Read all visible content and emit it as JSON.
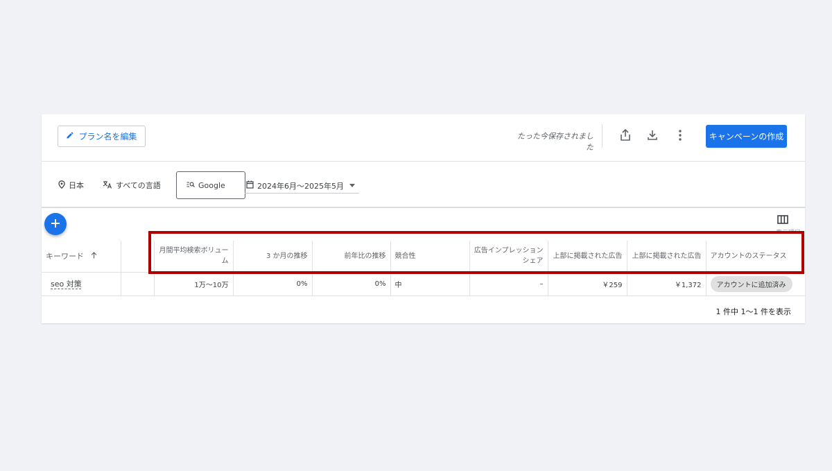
{
  "header": {
    "edit_plan_label": "プラン名を編集",
    "saved_status": "たった今保存されました",
    "create_campaign_label": "キャンペーンの作成",
    "icons": [
      "pencil-icon",
      "share-icon",
      "download-icon",
      "more-vert-icon"
    ]
  },
  "filters": {
    "location": "日本",
    "language": "すべての言語",
    "network": "Google",
    "date_range": "2024年6月〜2025年5月"
  },
  "table": {
    "column_toggle_label": "表示項目",
    "headers": {
      "keyword": "キーワード",
      "monthly_volume": "月間平均検索ボリューム",
      "three_month": "3 か月の推移",
      "yoy": "前年比の推移",
      "competition": "競合性",
      "impression_share": "広告インプレッション シェア",
      "top_bid_low": "上部に掲載された広告",
      "top_bid_high": "上部に掲載された広告",
      "account_status": "アカウントのステータス"
    },
    "rows": [
      {
        "keyword": "seo 対策",
        "monthly_volume": "1万〜10万",
        "three_month": "0%",
        "yoy": "0%",
        "competition": "中",
        "impression_share": "–",
        "top_bid_low": "￥259",
        "top_bid_high": "￥1,372",
        "account_status": "アカウントに追加済み"
      }
    ],
    "pagination": "1 件中 1〜1 件を表示"
  },
  "colors": {
    "primary": "#1a73e8",
    "highlight": "#b00000",
    "background": "#f1f2f6"
  }
}
